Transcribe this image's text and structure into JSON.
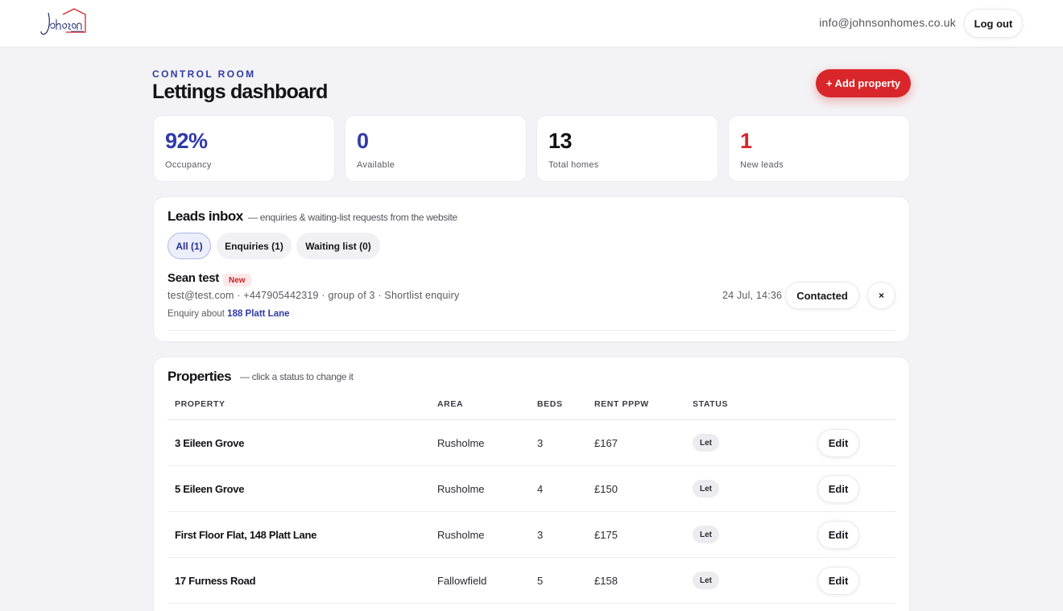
{
  "header": {
    "email": "info@johnsonhomes.co.uk",
    "logout_label": "Log out"
  },
  "page": {
    "eyebrow": "CONTROL ROOM",
    "title": "Lettings dashboard",
    "add_label": "+ Add property"
  },
  "stats": [
    {
      "value": "92%",
      "label": "Occupancy",
      "color": "#2f3aa8"
    },
    {
      "value": "0",
      "label": "Available",
      "color": "#2f3aa8"
    },
    {
      "value": "13",
      "label": "Total homes",
      "color": "#131316"
    },
    {
      "value": "1",
      "label": "New leads",
      "color": "#d8262b"
    }
  ],
  "leads": {
    "title": "Leads inbox",
    "subtitle": "— enquiries & waiting-list requests from the website",
    "tabs": [
      {
        "label": "All (1)"
      },
      {
        "label": "Enquiries (1)"
      },
      {
        "label": "Waiting list (0)"
      }
    ],
    "items": [
      {
        "name": "Sean test",
        "badge": "New",
        "meta": "test@test.com · +447905442319 · group of 3 · Shortlist enquiry",
        "about_prefix": "Enquiry about",
        "about_link": "188 Platt Lane",
        "time": "24 Jul, 14:36",
        "contacted_label": "Contacted",
        "dismiss_label": "×"
      }
    ]
  },
  "properties": {
    "title": "Properties",
    "subtitle": "— click a status to change it",
    "columns": {
      "property": "PROPERTY",
      "area": "AREA",
      "beds": "BEDS",
      "rent": "RENT PPPW",
      "status": "STATUS"
    },
    "edit_label": "Edit",
    "rows": [
      {
        "name": "3 Eileen Grove",
        "area": "Rusholme",
        "beds": "3",
        "rent": "£167",
        "status": "Let"
      },
      {
        "name": "5 Eileen Grove",
        "area": "Rusholme",
        "beds": "4",
        "rent": "£150",
        "status": "Let"
      },
      {
        "name": "First Floor Flat, 148 Platt Lane",
        "area": "Rusholme",
        "beds": "3",
        "rent": "£175",
        "status": "Let"
      },
      {
        "name": "17 Furness Road",
        "area": "Fallowfield",
        "beds": "5",
        "rent": "£158",
        "status": "Let"
      }
    ]
  }
}
